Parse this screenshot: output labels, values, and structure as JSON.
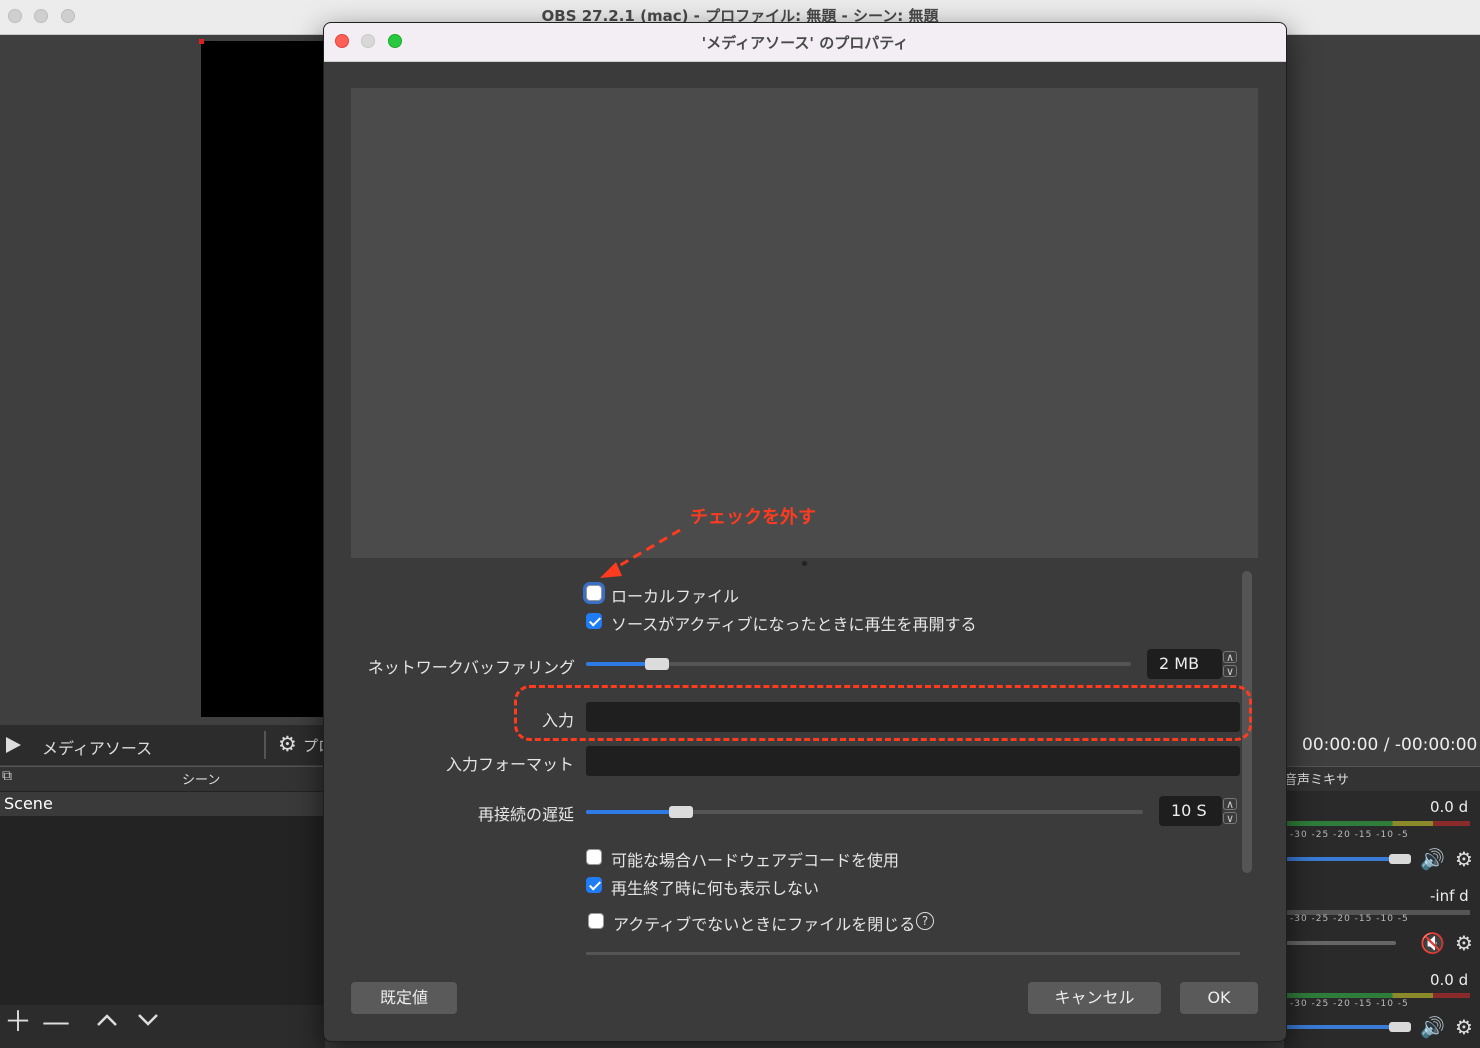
{
  "main_window": {
    "title": "OBS 27.2.1 (mac) - プロファイル: 無題 - シーン: 無題",
    "source_toolbar": {
      "source_name": "メディアソース",
      "properties_label": "プロ"
    },
    "scenes": {
      "title": "シーン",
      "items": [
        "Scene"
      ]
    },
    "mixer": {
      "title": "音声ミキサー",
      "time": "00:00:00 / -00:00:00",
      "channels": [
        {
          "db": "0.0 d",
          "muted": false
        },
        {
          "db": "-inf d",
          "muted": true
        },
        {
          "db": "0.0 d",
          "muted": false
        }
      ],
      "ticks": "-30 -25 -20 -15 -10 -5"
    }
  },
  "dialog": {
    "title": "'メディアソース' のプロパティ",
    "local_file": {
      "label": "ローカルファイル",
      "checked": false
    },
    "restart_on_active": {
      "label": "ソースがアクティブになったときに再生を再開する",
      "checked": true
    },
    "network_buffering": {
      "label": "ネットワークバッファリング",
      "value": "2 MB",
      "fraction": 0.13
    },
    "input": {
      "label": "入力",
      "value": ""
    },
    "input_format": {
      "label": "入力フォーマット",
      "value": ""
    },
    "reconnect_delay": {
      "label": "再接続の遅延",
      "value": "10 S",
      "fraction": 0.17
    },
    "hw_decode": {
      "label": "可能な場合ハードウェアデコードを使用",
      "checked": false
    },
    "show_nothing_on_end": {
      "label": "再生終了時に何も表示しない",
      "checked": true
    },
    "close_when_inactive": {
      "label": "アクティブでないときにファイルを閉じる",
      "checked": false
    },
    "buttons": {
      "defaults": "既定値",
      "cancel": "キャンセル",
      "ok": "OK"
    }
  },
  "annotation": {
    "text": "チェックを外す",
    "color": "#ff3b1f"
  }
}
